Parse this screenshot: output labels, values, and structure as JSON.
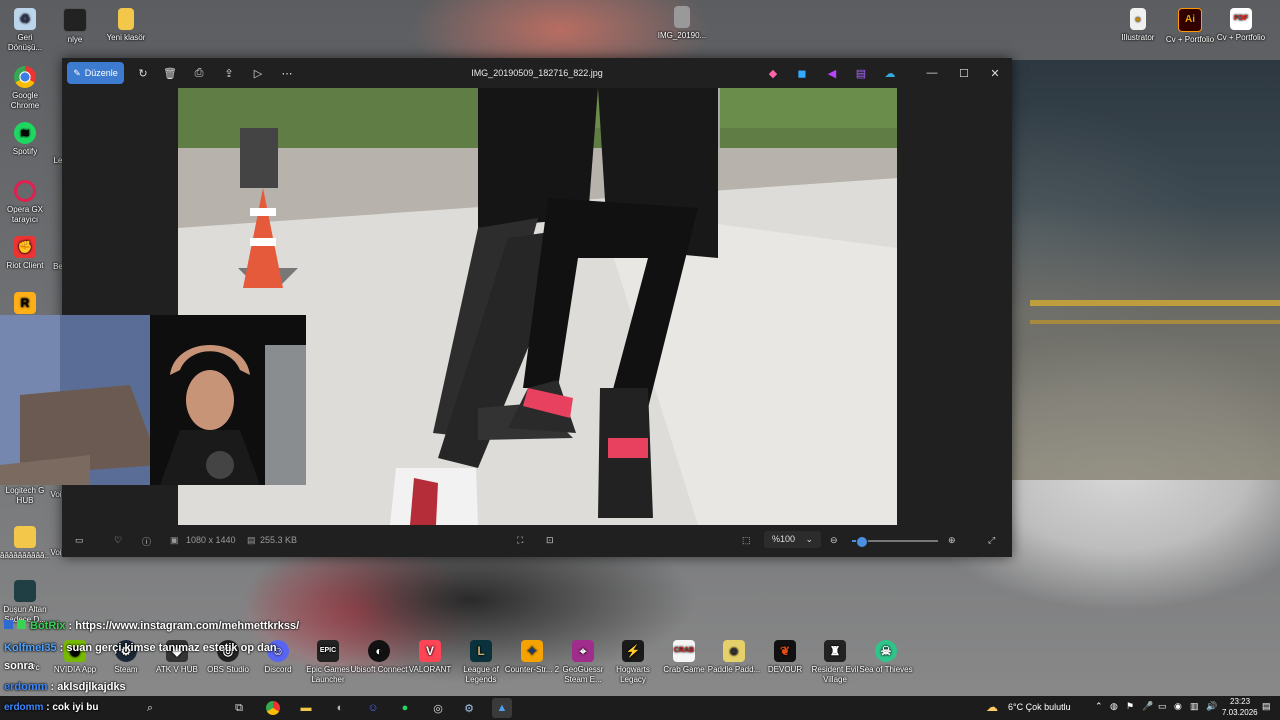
{
  "desktop": {
    "icons_left": [
      {
        "label": "Geri Dönüşü...",
        "icon": "recycle-bin-icon"
      },
      {
        "label": "Google Chrome",
        "icon": "chrome-icon"
      },
      {
        "label": "Spotify",
        "icon": "spotify-icon"
      },
      {
        "label": "Opera GX tarayıcı",
        "icon": "opera-gx-icon"
      },
      {
        "label": "Riot Client",
        "icon": "riot-client-icon"
      },
      {
        "label": "Logitech G HUB",
        "icon": "logitech-icon"
      },
      {
        "label": "ââââââââââ...",
        "icon": "folder-icon"
      },
      {
        "label": "Duşun Altan Sadece D...",
        "icon": "game-icon"
      }
    ],
    "icons_top": [
      {
        "label": "nlye",
        "icon": "file-icon"
      },
      {
        "label": "Yeni klasör",
        "icon": "folder-icon"
      },
      {
        "label": "IMG_20190...",
        "icon": "image-icon"
      }
    ],
    "icons_right": [
      {
        "label": "Illustrator",
        "icon": "file-icon"
      },
      {
        "label": "Cv + Portfolio",
        "icon": "illustrator-icon"
      },
      {
        "label": "Cv + Portfolio",
        "icon": "pdf-icon"
      }
    ],
    "partial_labels": [
      "Le",
      "Be",
      "Voi",
      "Voi",
      "Pc"
    ],
    "bottom_apps": [
      {
        "label": "Logitech G HUB",
        "icon": "app-icon"
      },
      {
        "label": "NVIDIA App",
        "icon": "nvidia-icon"
      },
      {
        "label": "Steam",
        "icon": "steam-icon"
      },
      {
        "label": "ATK V HUB",
        "icon": "atk-icon"
      },
      {
        "label": "OBS Studio",
        "icon": "obs-icon"
      },
      {
        "label": "Discord",
        "icon": "discord-icon"
      },
      {
        "label": "Epic Games Launcher",
        "icon": "epic-icon"
      },
      {
        "label": "Ubisoft Connect",
        "icon": "ubisoft-icon"
      },
      {
        "label": "VALORANT",
        "icon": "valorant-icon"
      },
      {
        "label": "League of Legends",
        "icon": "lol-icon"
      },
      {
        "label": "Counter-Str... 2",
        "icon": "cs2-icon"
      },
      {
        "label": "GeoGuessr Steam E...",
        "icon": "geoguessr-icon"
      },
      {
        "label": "Hogwarts Legacy",
        "icon": "hogwarts-icon"
      },
      {
        "label": "Crab Game",
        "icon": "crab-icon"
      },
      {
        "label": "Paddle Padd...",
        "icon": "paddle-icon"
      },
      {
        "label": "DEVOUR",
        "icon": "devour-icon"
      },
      {
        "label": "Resident Evil Village",
        "icon": "re-icon"
      },
      {
        "label": "Sea of Thieves",
        "icon": "sot-icon"
      }
    ]
  },
  "photos_window": {
    "edit_label": "Düzenle",
    "title": "IMG_20190509_182716_822.jpg",
    "dimensions": "1080 x 1440",
    "filesize": "255.3 KB",
    "zoom": "%100",
    "zoom_level": 0.1
  },
  "chat": [
    {
      "user": "BotRix",
      "text": ": https://www.instagram.com/mehmettkrkss/"
    },
    {
      "user": "Kolfmei35",
      "text": ": suan gerçi kimse tanımaz estetik op dan"
    },
    {
      "user": "",
      "text": "sonra"
    },
    {
      "user": "erdomm",
      "text": ": aklsdjlkajdks"
    },
    {
      "user": "erdomm",
      "text": ": cok iyi bu"
    }
  ],
  "taskbar": {
    "weather": "6°C  Çok bulutlu",
    "time": "23:23",
    "date": "7.03.2026"
  }
}
